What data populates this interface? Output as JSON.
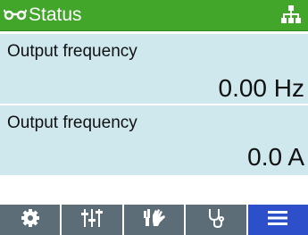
{
  "header": {
    "title": "Status",
    "icons": [
      "glasses-icon",
      "network-icon"
    ],
    "color": "#41a62a"
  },
  "panels": [
    {
      "label": "Output frequency",
      "value": "0.00 Hz"
    },
    {
      "label": "Output frequency",
      "value": "0.0 A"
    }
  ],
  "panel_color": "#cfe8ee",
  "toolbar": {
    "items": [
      {
        "icon": "gear-icon",
        "active": false
      },
      {
        "icon": "sliders-icon",
        "active": false
      },
      {
        "icon": "hand-icon",
        "active": false
      },
      {
        "icon": "stethoscope-icon",
        "active": false
      },
      {
        "icon": "menu-icon",
        "active": true
      }
    ],
    "background": "#5d6d78",
    "active_color": "#2d4fc9"
  }
}
